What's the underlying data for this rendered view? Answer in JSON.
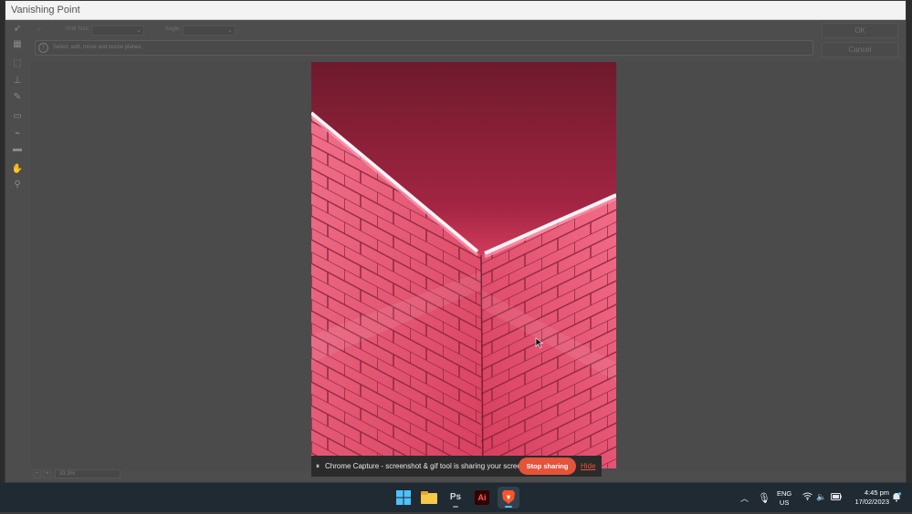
{
  "dialog": {
    "title": "Vanishing Point",
    "options": {
      "grid_size_label": "Grid Size:",
      "grid_size_value": "",
      "angle_label": "Angle:",
      "angle_value": ""
    },
    "info_text": "Select, edit, move and resize planes.",
    "ok_label": "OK",
    "cancel_label": "Cancel",
    "zoom_value": "33.3%"
  },
  "tools": [
    {
      "name": "edit-plane-tool-icon"
    },
    {
      "name": "create-plane-tool-icon"
    },
    {
      "name": "marquee-tool-icon"
    },
    {
      "name": "stamp-tool-icon"
    },
    {
      "name": "brush-tool-icon"
    },
    {
      "name": "transform-tool-icon"
    },
    {
      "name": "eyedropper-tool-icon"
    },
    {
      "name": "measure-tool-icon"
    },
    {
      "name": "hand-tool-icon"
    },
    {
      "name": "zoom-tool-icon"
    }
  ],
  "share_notice": {
    "message": "Chrome Capture - screenshot & gif tool is sharing your screen.",
    "stop_label": "Stop sharing",
    "hide_label": "Hide"
  },
  "taskbar": {
    "apps": [
      {
        "name": "windows-start-icon",
        "label": ""
      },
      {
        "name": "file-explorer-icon",
        "label": ""
      },
      {
        "name": "photoshop-icon",
        "label": "Ps"
      },
      {
        "name": "illustrator-icon",
        "label": "Ai"
      },
      {
        "name": "brave-browser-icon",
        "label": ""
      }
    ],
    "lang_line1": "ENG",
    "lang_line2": "US",
    "time": "4:45 pm",
    "date": "17/02/2023"
  },
  "colors": {
    "photo_pink": "#d9405f",
    "share_button": "#e5533a",
    "taskbar": "#1f2a33"
  }
}
